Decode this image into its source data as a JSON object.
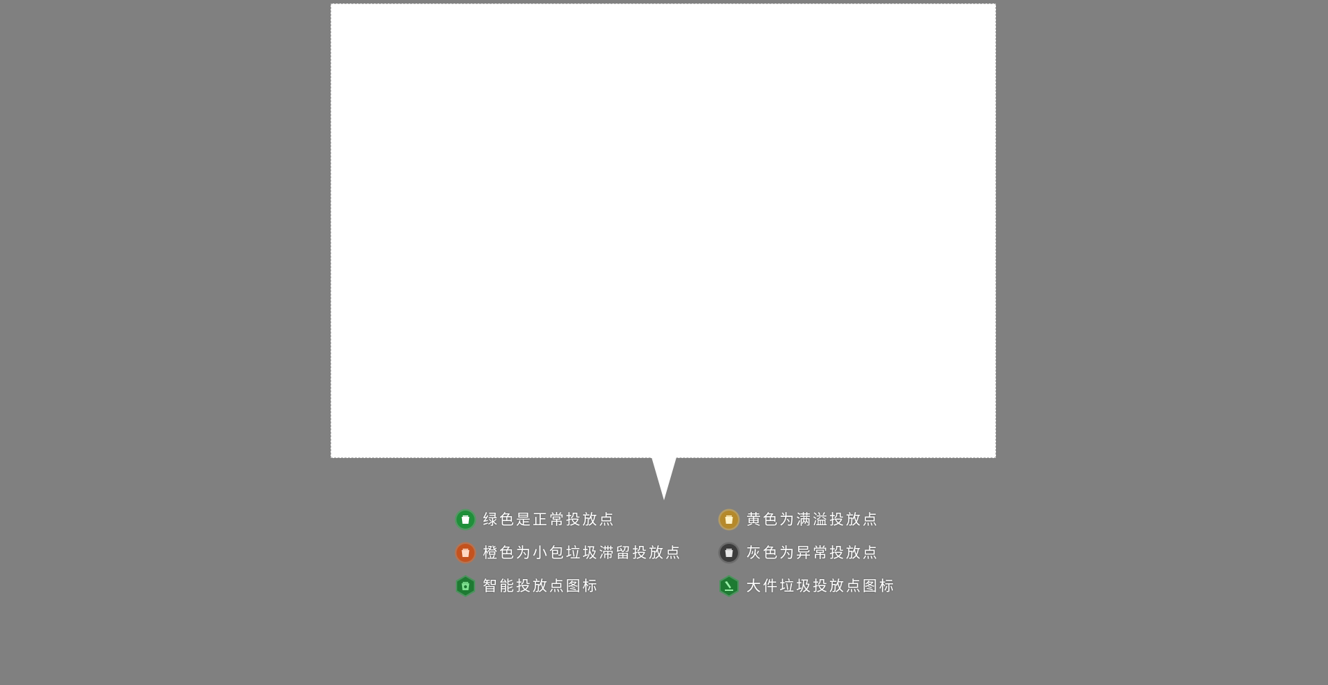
{
  "popup": {
    "content": ""
  },
  "legend": {
    "items": [
      {
        "key": "normal",
        "label": "绿色是正常投放点",
        "icon": "trash-bin-icon",
        "shape": "circle",
        "color": "#1f8f3a",
        "ring": "#2faa4a"
      },
      {
        "key": "full",
        "label": "黄色为满溢投放点",
        "icon": "trash-bin-icon",
        "shape": "circle",
        "color": "#b5892a",
        "ring": "#e0b24a"
      },
      {
        "key": "retention",
        "label": "橙色为小包垃圾滞留投放点",
        "icon": "trash-bin-icon",
        "shape": "circle",
        "color": "#c4521e",
        "ring": "#e06a2e"
      },
      {
        "key": "abnormal",
        "label": "灰色为异常投放点",
        "icon": "trash-bin-icon",
        "shape": "circle",
        "color": "#3c3c3c",
        "ring": "#5a5a5a"
      },
      {
        "key": "smart",
        "label": "智能投放点图标",
        "icon": "smart-bin-icon",
        "shape": "hexagon",
        "color": "#1e7a32",
        "ring": "#2aa046"
      },
      {
        "key": "bulky",
        "label": "大件垃圾投放点图标",
        "icon": "bulky-waste-icon",
        "shape": "hexagon",
        "color": "#1e7a32",
        "ring": "#2aa046"
      }
    ]
  }
}
